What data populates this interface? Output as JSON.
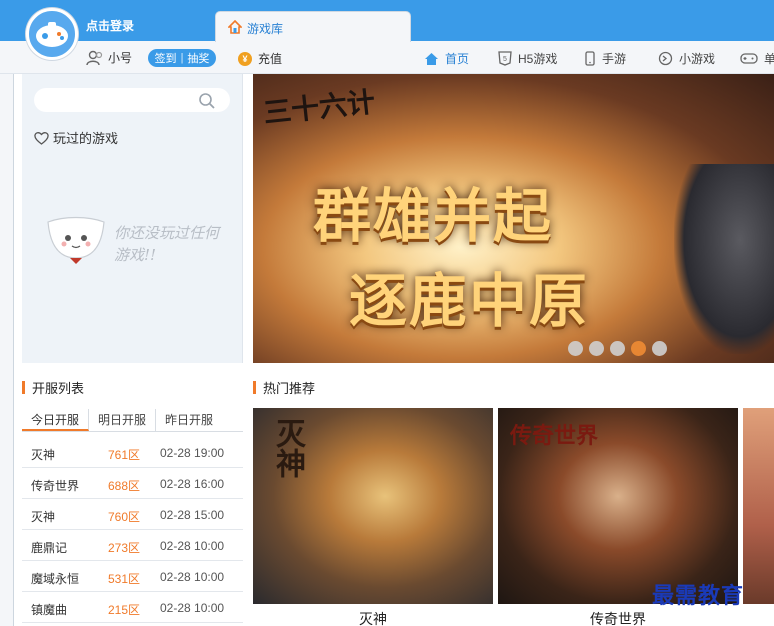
{
  "header": {
    "login_text": "点击登录",
    "tab_label": "游戏库",
    "colors": {
      "topbar": "#3a9be8",
      "accent": "#2a82d4",
      "orange": "#f07a2a"
    }
  },
  "user_nav": {
    "account_label": "小号",
    "sign_label": "签到",
    "lottery_label": "抽奖",
    "recharge_label": "充值"
  },
  "nav": {
    "items": [
      {
        "label": "首页",
        "icon": "home-icon",
        "active": true
      },
      {
        "label": "H5游戏",
        "icon": "html5-icon",
        "active": false
      },
      {
        "label": "手游",
        "icon": "phone-icon",
        "active": false
      },
      {
        "label": "小游戏",
        "icon": "mini-game-icon",
        "active": false
      },
      {
        "label": "单",
        "icon": "gamepad-icon",
        "active": false
      }
    ]
  },
  "sidebar": {
    "search_placeholder": "",
    "played_label": "玩过的游戏",
    "empty_text": "你还没玩过任何游戏!!"
  },
  "banner": {
    "logo_text": "三十六计",
    "slogan_line1": "群雄并起",
    "slogan_line2": "逐鹿中原",
    "active_slide": 4,
    "slide_count": 5
  },
  "servers": {
    "title": "开服列表",
    "tabs": [
      "今日开服",
      "明日开服",
      "昨日开服"
    ],
    "active_tab": 0,
    "rows": [
      {
        "game": "灭神",
        "zone": "761区",
        "time": "02-28 19:00"
      },
      {
        "game": "传奇世界",
        "zone": "688区",
        "time": "02-28 16:00"
      },
      {
        "game": "灭神",
        "zone": "760区",
        "time": "02-28 15:00"
      },
      {
        "game": "鹿鼎记",
        "zone": "273区",
        "time": "02-28 10:00"
      },
      {
        "game": "魔域永恒",
        "zone": "531区",
        "time": "02-28 10:00"
      },
      {
        "game": "镇魔曲",
        "zone": "215区",
        "time": "02-28 10:00"
      }
    ]
  },
  "hot": {
    "title": "热门推荐",
    "cards": [
      {
        "name": "灭神",
        "art_title": "灭神"
      },
      {
        "name": "传奇世界",
        "art_title": "传奇世界"
      }
    ]
  },
  "watermark": "最需教育"
}
